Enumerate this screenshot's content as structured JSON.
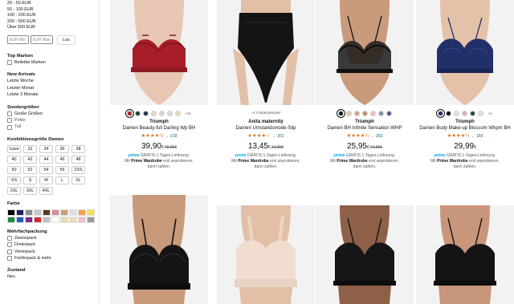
{
  "sidebar": {
    "price_links": [
      "20 - 50 EUR",
      "50 - 100 EUR",
      "100 - 200 EUR",
      "200 - 500 EUR",
      "Über 500 EUR"
    ],
    "min_placeholder": "EUR Min",
    "max_placeholder": "EUR Max",
    "go_label": "Los",
    "top_brands": {
      "heading": "Top Marken",
      "item": "Beliebte Marken"
    },
    "new_arrivals": {
      "heading": "New Arrivals",
      "items": [
        "Letzte Woche",
        "Letzter Monat",
        "Letzte 3 Monate"
      ]
    },
    "special_sizes": {
      "heading": "Sondergrößen",
      "items": [
        "Große Größen",
        "Petite",
        "Tall"
      ]
    },
    "clothing_size": {
      "heading": "Konfektionsgröße Damen",
      "sizes": [
        "1size",
        "32",
        "34",
        "36",
        "38",
        "40",
        "42",
        "44",
        "46",
        "48",
        "50",
        "52",
        "54",
        "56",
        "2XS",
        "XS",
        "S",
        "M",
        "L",
        "XL",
        "2XL",
        "3XL",
        "4XL"
      ]
    },
    "color": {
      "heading": "Farbe",
      "swatches": [
        "#000000",
        "#1f1f5e",
        "#8a8f96",
        "#c8c8c8",
        "#5b3a22",
        "#d98b9c",
        "#c8a27a",
        "#e0e0e0",
        "#f2a24a",
        "#f6e04d",
        "#1a8a3a",
        "#2456c5",
        "#7a2a8a",
        "#d32b2b",
        "#c0c0c0",
        "#ffffff",
        "#f0d7b5",
        "#e8e0c0",
        "#f6c0d0",
        "#9a9a9a"
      ]
    },
    "multipack": {
      "heading": "Mehrfachpackung",
      "items": [
        "Zweierpack",
        "Dreierpack",
        "Viererpack",
        "Fünferpack & mehr"
      ]
    },
    "condition": {
      "heading": "Zustand",
      "item": "Neu"
    }
  },
  "products": [
    {
      "swatch_colors": [
        "#b01e2a",
        "#223b2f",
        "#20304a",
        "#e8d2c4",
        "#d0d6dc",
        "#e2d8c8",
        "#e8d8b8"
      ],
      "more_colors": "+11",
      "brand": "Triumph",
      "title": "Damen Beauty-full Darling Wp BH",
      "stars": "★★★★½",
      "rating_count": "218",
      "price_int": "39,90",
      "price_sup": "€",
      "price_old": "49,95€",
      "prime_label": "prime",
      "ship_line1": "GRATIS 1-Tages-Lieferung.",
      "ship_line2_pre": "Mit",
      "ship_bold": "Prime Wardrobe",
      "ship_line2_post": "erst anprobieren,",
      "ship_line3": "dann zahlen.",
      "image": "red underwire bra with lace"
    },
    {
      "colors_text": "+1 Farben/Muster",
      "brand": "Anita maternity",
      "title": "Damen Umstandsmode-Slip",
      "stars": "★★★★☆",
      "rating_count": "301",
      "price_int": "13,45",
      "price_sup": "€",
      "price_old": "14,95€",
      "prime_label": "prime",
      "ship_line1": "GRATIS 1-Tages-Lieferung.",
      "ship_line2_pre": "Mit",
      "ship_bold": "Prime Wardrobe",
      "ship_line2_post": "erst anprobieren,",
      "ship_line3": "dann zahlen.",
      "image": "black high-waist maternity brief"
    },
    {
      "swatch_colors": [
        "#111111",
        "#e8c8b0",
        "#e0a070",
        "#c09070",
        "#f0b8c0",
        "#8a8fa8",
        "#505890"
      ],
      "brand": "Triumph",
      "title": "Damen BH Infinite Sensation WHP",
      "stars": "★★★★½",
      "rating_count": "263",
      "price_int": "25,95",
      "price_sup": "€",
      "price_old": "44,95€",
      "prime_label": "prime",
      "ship_line1": "GRATIS 1-Tages-Lieferung.",
      "ship_line2_pre": "Mit",
      "ship_bold": "Prime Wardrobe",
      "ship_line2_post": "erst anprobieren,",
      "ship_line3": "dann zahlen.",
      "image": "black sheer underwire bra"
    },
    {
      "swatch_colors": [
        "#1f2b5e",
        "#111111",
        "#e8e0d8",
        "#d8b8a0",
        "#1a4a3a",
        "#e8e0d0"
      ],
      "more_colors": "+4",
      "brand": "Triumph",
      "title": "Damen Body Make-up Blossom Whpm BH",
      "stars": "★★★★½",
      "rating_count": "169",
      "price_int": "29,99",
      "price_sup": "€",
      "prime_label": "prime",
      "ship_line1": "GRATIS 1-Tages-Lieferung.",
      "ship_line2_pre": "Mit",
      "ship_bold": "Prime Wardrobe",
      "ship_line2_post": "erst anprobieren,",
      "ship_line3": "dann zahlen.",
      "image": "navy blue lace bra"
    }
  ],
  "row2_images": [
    "black minimizer bra",
    "nude soft bralette",
    "black plunge bra",
    "black t-shirt bra"
  ]
}
